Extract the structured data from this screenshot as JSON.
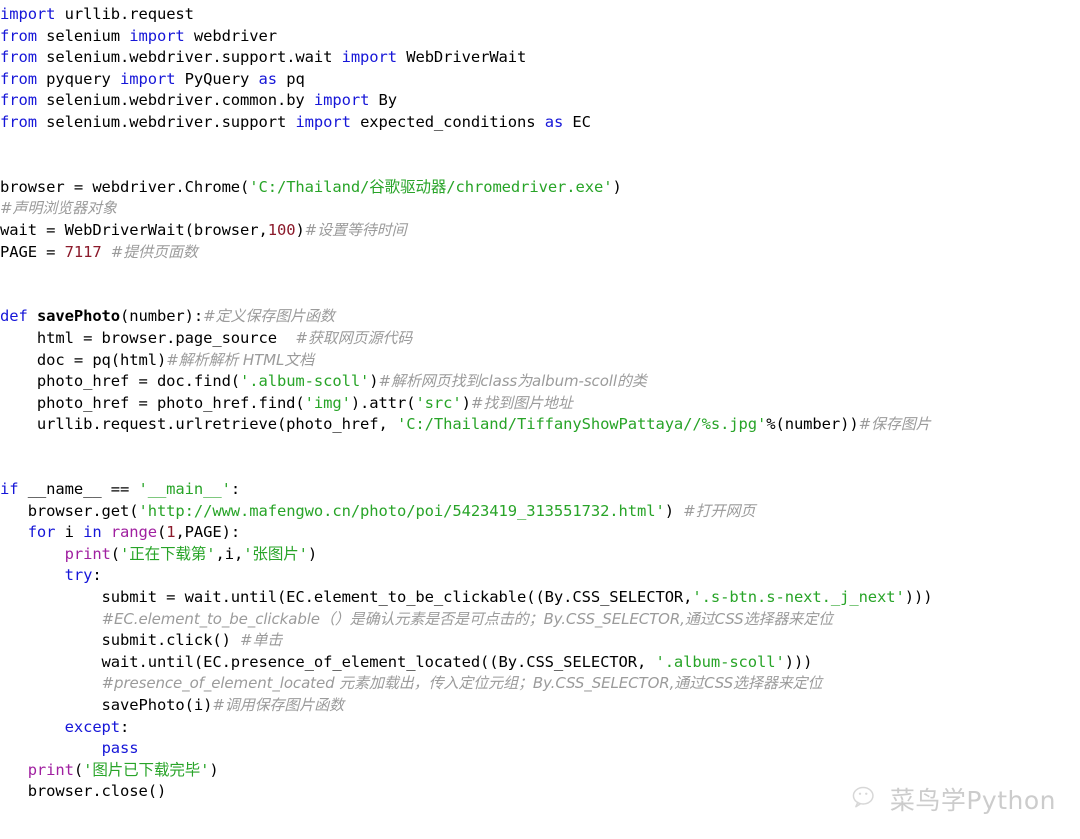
{
  "document": {
    "kind": "python-source-listing",
    "language": "Python",
    "colors": {
      "background": "#ffffff",
      "plain": "#000000",
      "keyword": "#1616d8",
      "builtin": "#a020a0",
      "string": "#28a428",
      "number": "#8b1a2b",
      "comment": "#9b9b9b",
      "watermark": "#b9b9b9"
    }
  },
  "code": {
    "lines": [
      {
        "id": "l1",
        "tokens": [
          {
            "t": "keyword",
            "v": "import"
          },
          {
            "t": "plain",
            "v": " urllib.request"
          }
        ]
      },
      {
        "id": "l2",
        "tokens": [
          {
            "t": "keyword",
            "v": "from"
          },
          {
            "t": "plain",
            "v": " selenium "
          },
          {
            "t": "keyword",
            "v": "import"
          },
          {
            "t": "plain",
            "v": " webdriver"
          }
        ]
      },
      {
        "id": "l3",
        "tokens": [
          {
            "t": "keyword",
            "v": "from"
          },
          {
            "t": "plain",
            "v": " selenium.webdriver.support.wait "
          },
          {
            "t": "keyword",
            "v": "import"
          },
          {
            "t": "plain",
            "v": " WebDriverWait"
          }
        ]
      },
      {
        "id": "l4",
        "tokens": [
          {
            "t": "keyword",
            "v": "from"
          },
          {
            "t": "plain",
            "v": " pyquery "
          },
          {
            "t": "keyword",
            "v": "import"
          },
          {
            "t": "plain",
            "v": " PyQuery "
          },
          {
            "t": "keyword",
            "v": "as"
          },
          {
            "t": "plain",
            "v": " pq"
          }
        ]
      },
      {
        "id": "l5",
        "tokens": [
          {
            "t": "keyword",
            "v": "from"
          },
          {
            "t": "plain",
            "v": " selenium.webdriver.common.by "
          },
          {
            "t": "keyword",
            "v": "import"
          },
          {
            "t": "plain",
            "v": " By"
          }
        ]
      },
      {
        "id": "l6",
        "tokens": [
          {
            "t": "keyword",
            "v": "from"
          },
          {
            "t": "plain",
            "v": " selenium.webdriver.support "
          },
          {
            "t": "keyword",
            "v": "import"
          },
          {
            "t": "plain",
            "v": " expected_conditions "
          },
          {
            "t": "keyword",
            "v": "as"
          },
          {
            "t": "plain",
            "v": " EC"
          }
        ]
      },
      {
        "id": "l7",
        "tokens": []
      },
      {
        "id": "l8",
        "tokens": []
      },
      {
        "id": "l9",
        "tokens": [
          {
            "t": "plain",
            "v": "browser = webdriver.Chrome("
          },
          {
            "t": "string",
            "v": "'C:/Thailand/谷歌驱动器/chromedriver.exe'"
          },
          {
            "t": "plain",
            "v": ")"
          }
        ]
      },
      {
        "id": "l10",
        "tokens": [
          {
            "t": "comment",
            "v": "#声明浏览器对象"
          }
        ]
      },
      {
        "id": "l11",
        "tokens": [
          {
            "t": "plain",
            "v": "wait = WebDriverWait(browser,"
          },
          {
            "t": "number",
            "v": "100"
          },
          {
            "t": "plain",
            "v": ")"
          },
          {
            "t": "comment",
            "v": "#设置等待时间"
          }
        ]
      },
      {
        "id": "l12",
        "tokens": [
          {
            "t": "plain",
            "v": "PAGE = "
          },
          {
            "t": "number",
            "v": "7117"
          },
          {
            "t": "plain",
            "v": " "
          },
          {
            "t": "comment",
            "v": "#提供页面数"
          }
        ]
      },
      {
        "id": "l13",
        "tokens": []
      },
      {
        "id": "l14",
        "tokens": []
      },
      {
        "id": "l15",
        "tokens": [
          {
            "t": "keyword",
            "v": "def"
          },
          {
            "t": "plain",
            "v": " "
          },
          {
            "t": "funcname",
            "v": "savePhoto"
          },
          {
            "t": "plain",
            "v": "(number):"
          },
          {
            "t": "comment",
            "v": "#定义保存图片函数"
          }
        ]
      },
      {
        "id": "l16",
        "tokens": [
          {
            "t": "plain",
            "v": "    html = browser.page_source  "
          },
          {
            "t": "comment",
            "v": "#获取网页源代码"
          }
        ]
      },
      {
        "id": "l17",
        "tokens": [
          {
            "t": "plain",
            "v": "    doc = pq(html)"
          },
          {
            "t": "comment",
            "v": "#解析解析 HTML文档"
          }
        ]
      },
      {
        "id": "l18",
        "tokens": [
          {
            "t": "plain",
            "v": "    photo_href = doc.find("
          },
          {
            "t": "string",
            "v": "'.album-scoll'"
          },
          {
            "t": "plain",
            "v": ")"
          },
          {
            "t": "comment",
            "v": "#解析网页找到class为album-scoll的类"
          }
        ]
      },
      {
        "id": "l19",
        "tokens": [
          {
            "t": "plain",
            "v": "    photo_href = photo_href.find("
          },
          {
            "t": "string",
            "v": "'img'"
          },
          {
            "t": "plain",
            "v": ").attr("
          },
          {
            "t": "string",
            "v": "'src'"
          },
          {
            "t": "plain",
            "v": ")"
          },
          {
            "t": "comment",
            "v": "#找到图片地址"
          }
        ]
      },
      {
        "id": "l20",
        "tokens": [
          {
            "t": "plain",
            "v": "    urllib.request.urlretrieve(photo_href, "
          },
          {
            "t": "string",
            "v": "'C:/Thailand/TiffanyShowPattaya//%s.jpg'"
          },
          {
            "t": "plain",
            "v": "%(number))"
          },
          {
            "t": "comment",
            "v": "#保存图片"
          }
        ]
      },
      {
        "id": "l21",
        "tokens": []
      },
      {
        "id": "l22",
        "tokens": []
      },
      {
        "id": "l23",
        "tokens": [
          {
            "t": "keyword",
            "v": "if"
          },
          {
            "t": "plain",
            "v": " __name__ == "
          },
          {
            "t": "string",
            "v": "'__main__'"
          },
          {
            "t": "plain",
            "v": ":"
          }
        ]
      },
      {
        "id": "l24",
        "tokens": [
          {
            "t": "plain",
            "v": "   browser.get("
          },
          {
            "t": "string",
            "v": "'http://www.mafengwo.cn/photo/poi/5423419_313551732.html'"
          },
          {
            "t": "plain",
            "v": ") "
          },
          {
            "t": "comment",
            "v": "#打开网页"
          }
        ]
      },
      {
        "id": "l25",
        "tokens": [
          {
            "t": "plain",
            "v": "   "
          },
          {
            "t": "keyword",
            "v": "for"
          },
          {
            "t": "plain",
            "v": " i "
          },
          {
            "t": "keyword",
            "v": "in"
          },
          {
            "t": "plain",
            "v": " "
          },
          {
            "t": "builtin",
            "v": "range"
          },
          {
            "t": "plain",
            "v": "("
          },
          {
            "t": "number",
            "v": "1"
          },
          {
            "t": "plain",
            "v": ",PAGE):"
          }
        ]
      },
      {
        "id": "l26",
        "tokens": [
          {
            "t": "plain",
            "v": "       "
          },
          {
            "t": "builtin",
            "v": "print"
          },
          {
            "t": "plain",
            "v": "("
          },
          {
            "t": "string",
            "v": "'正在下载第'"
          },
          {
            "t": "plain",
            "v": ",i,"
          },
          {
            "t": "string",
            "v": "'张图片'"
          },
          {
            "t": "plain",
            "v": ")"
          }
        ]
      },
      {
        "id": "l27",
        "tokens": [
          {
            "t": "plain",
            "v": "       "
          },
          {
            "t": "keyword",
            "v": "try"
          },
          {
            "t": "plain",
            "v": ":"
          }
        ]
      },
      {
        "id": "l28",
        "tokens": [
          {
            "t": "plain",
            "v": "           submit = wait.until(EC.element_to_be_clickable((By.CSS_SELECTOR,"
          },
          {
            "t": "string",
            "v": "'.s-btn.s-next._j_next'"
          },
          {
            "t": "plain",
            "v": ")))"
          }
        ]
      },
      {
        "id": "l29",
        "tokens": [
          {
            "t": "plain",
            "v": "           "
          },
          {
            "t": "comment",
            "v": "#EC.element_to_be_clickable（）是确认元素是否是可点击的；By.CSS_SELECTOR,通过CSS选择器来定位"
          }
        ]
      },
      {
        "id": "l30",
        "tokens": [
          {
            "t": "plain",
            "v": "           submit.click() "
          },
          {
            "t": "comment",
            "v": "#单击"
          }
        ]
      },
      {
        "id": "l31",
        "tokens": [
          {
            "t": "plain",
            "v": "           wait.until(EC.presence_of_element_located((By.CSS_SELECTOR, "
          },
          {
            "t": "string",
            "v": "'.album-scoll'"
          },
          {
            "t": "plain",
            "v": ")))"
          }
        ]
      },
      {
        "id": "l32",
        "tokens": [
          {
            "t": "plain",
            "v": "           "
          },
          {
            "t": "comment",
            "v": "#presence_of_element_located 元素加载出，传入定位元组；By.CSS_SELECTOR,通过CSS选择器来定位"
          }
        ]
      },
      {
        "id": "l33",
        "tokens": [
          {
            "t": "plain",
            "v": "           savePhoto(i)"
          },
          {
            "t": "comment",
            "v": "#调用保存图片函数"
          }
        ]
      },
      {
        "id": "l34",
        "tokens": [
          {
            "t": "plain",
            "v": "       "
          },
          {
            "t": "keyword",
            "v": "except"
          },
          {
            "t": "plain",
            "v": ":"
          }
        ]
      },
      {
        "id": "l35",
        "tokens": [
          {
            "t": "plain",
            "v": "           "
          },
          {
            "t": "keyword",
            "v": "pass"
          }
        ]
      },
      {
        "id": "l36",
        "tokens": [
          {
            "t": "plain",
            "v": "   "
          },
          {
            "t": "builtin",
            "v": "print"
          },
          {
            "t": "plain",
            "v": "("
          },
          {
            "t": "string",
            "v": "'图片已下载完毕'"
          },
          {
            "t": "plain",
            "v": ")"
          }
        ]
      },
      {
        "id": "l37",
        "tokens": [
          {
            "t": "plain",
            "v": "   browser.close()"
          }
        ]
      }
    ]
  },
  "watermark": {
    "icon": "wechat-icon",
    "text": "菜鸟学Python"
  }
}
